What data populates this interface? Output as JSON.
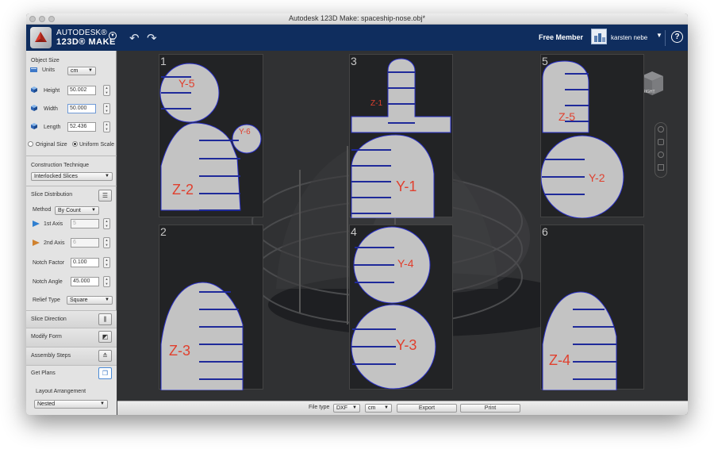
{
  "window": {
    "title": "Autodesk 123D Make: spaceship-nose.obj*"
  },
  "app": {
    "brand_line1": "AUTODESK®",
    "brand_line2": "123D® MAKE",
    "membership": "Free Member",
    "username": "karsten nebe",
    "help_label": "?"
  },
  "sidebar": {
    "object_size": {
      "title": "Object Size",
      "units_label": "Units",
      "units_value": "cm",
      "height_label": "Height",
      "height_value": "50.002",
      "width_label": "Width",
      "width_value": "50.000",
      "length_label": "Length",
      "length_value": "52.436",
      "original_scale": "Original Size",
      "uniform_scale": "Uniform Scale"
    },
    "construction": {
      "title": "Construction Technique",
      "value": "Interlocked Slices"
    },
    "slice_distribution": {
      "title": "Slice Distribution",
      "method_label": "Method",
      "method_value": "By Count",
      "axis1_label": "1st Axis",
      "axis1_value": "5",
      "axis2_label": "2nd Axis",
      "axis2_value": "6",
      "notch_factor_label": "Notch Factor",
      "notch_factor_value": "0.100",
      "notch_angle_label": "Notch Angle",
      "notch_angle_value": "45.000",
      "relief_label": "Relief Type",
      "relief_value": "Square"
    },
    "sections": {
      "slice_direction": "Slice Direction",
      "modify_form": "Modify Form",
      "assembly_steps": "Assembly Steps",
      "get_plans": "Get Plans"
    },
    "layout": {
      "title": "Layout Arrangement",
      "value": "Nested"
    }
  },
  "viewport": {
    "viewcube_label": "RIGHT",
    "sheets": [
      {
        "num": "1",
        "labels": [
          "Y-5",
          "Y-6",
          "Z-2"
        ]
      },
      {
        "num": "2",
        "labels": [
          "Z-3"
        ]
      },
      {
        "num": "3",
        "labels": [
          "Z-1",
          "Y-1"
        ]
      },
      {
        "num": "4",
        "labels": [
          "Y-4",
          "Y-3"
        ]
      },
      {
        "num": "5",
        "labels": [
          "Z-5",
          "Y-2"
        ]
      },
      {
        "num": "6",
        "labels": [
          "Z-4"
        ]
      }
    ]
  },
  "bottom": {
    "file_type_label": "File type",
    "file_type_value": "DXF",
    "unit_value": "cm",
    "export_label": "Export",
    "print_label": "Print"
  },
  "colors": {
    "app_bar": "#0f2d5e",
    "piece_fill": "#c3c3c3",
    "piece_stroke": "#2a30c8",
    "slot_line": "#1f2a9a",
    "label_red": "#e0402e",
    "sheet_bg": "#222325",
    "viewport_bg": "#303133"
  }
}
